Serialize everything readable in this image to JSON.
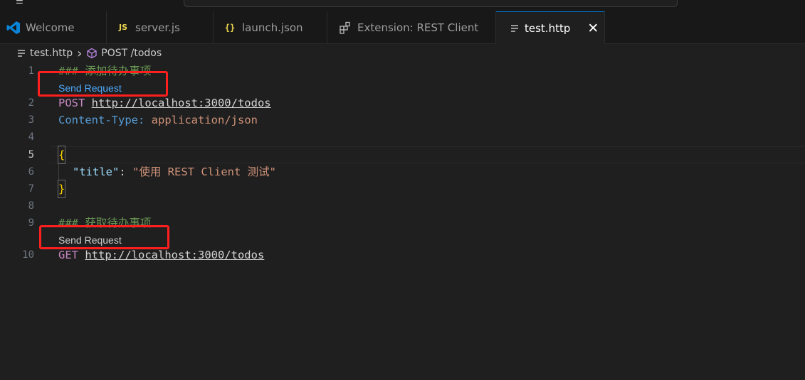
{
  "tabs": [
    {
      "label": "Welcome",
      "icon": "vscode-icon"
    },
    {
      "label": "server.js",
      "icon": "js-file-icon",
      "badge": "JS"
    },
    {
      "label": "launch.json",
      "icon": "json-file-icon",
      "badge": "{}"
    },
    {
      "label": "Extension: REST Client",
      "icon": "extension-icon"
    },
    {
      "label": "test.http",
      "icon": "text-file-icon",
      "active": true,
      "close": "✕"
    }
  ],
  "breadcrumb": {
    "file": "test.http",
    "symbol": "POST /todos",
    "sep": "›"
  },
  "code_lens": {
    "send_request": "Send Request"
  },
  "lines": [
    {
      "n": "1",
      "comment": "### 添加待办事项"
    },
    {
      "n": "2",
      "method": "POST",
      "url": "http://localhost:3000/todos"
    },
    {
      "n": "3",
      "header_name": "Content-Type:",
      "header_value": "application/json"
    },
    {
      "n": "4"
    },
    {
      "n": "5",
      "brace": "{"
    },
    {
      "n": "6",
      "key": "\"title\"",
      "colon": ":",
      "value": "\"使用 REST Client 测试\""
    },
    {
      "n": "7",
      "brace": "}"
    },
    {
      "n": "8"
    },
    {
      "n": "9",
      "comment": "### 获取待办事项"
    },
    {
      "n": "10",
      "method": "GET",
      "url": "http://localhost:3000/todos"
    }
  ],
  "colors": {
    "accent": "#0078d4",
    "highlight_box": "#ff1f1f",
    "lens_active": "#4daafc",
    "lens": "#cccccc"
  }
}
